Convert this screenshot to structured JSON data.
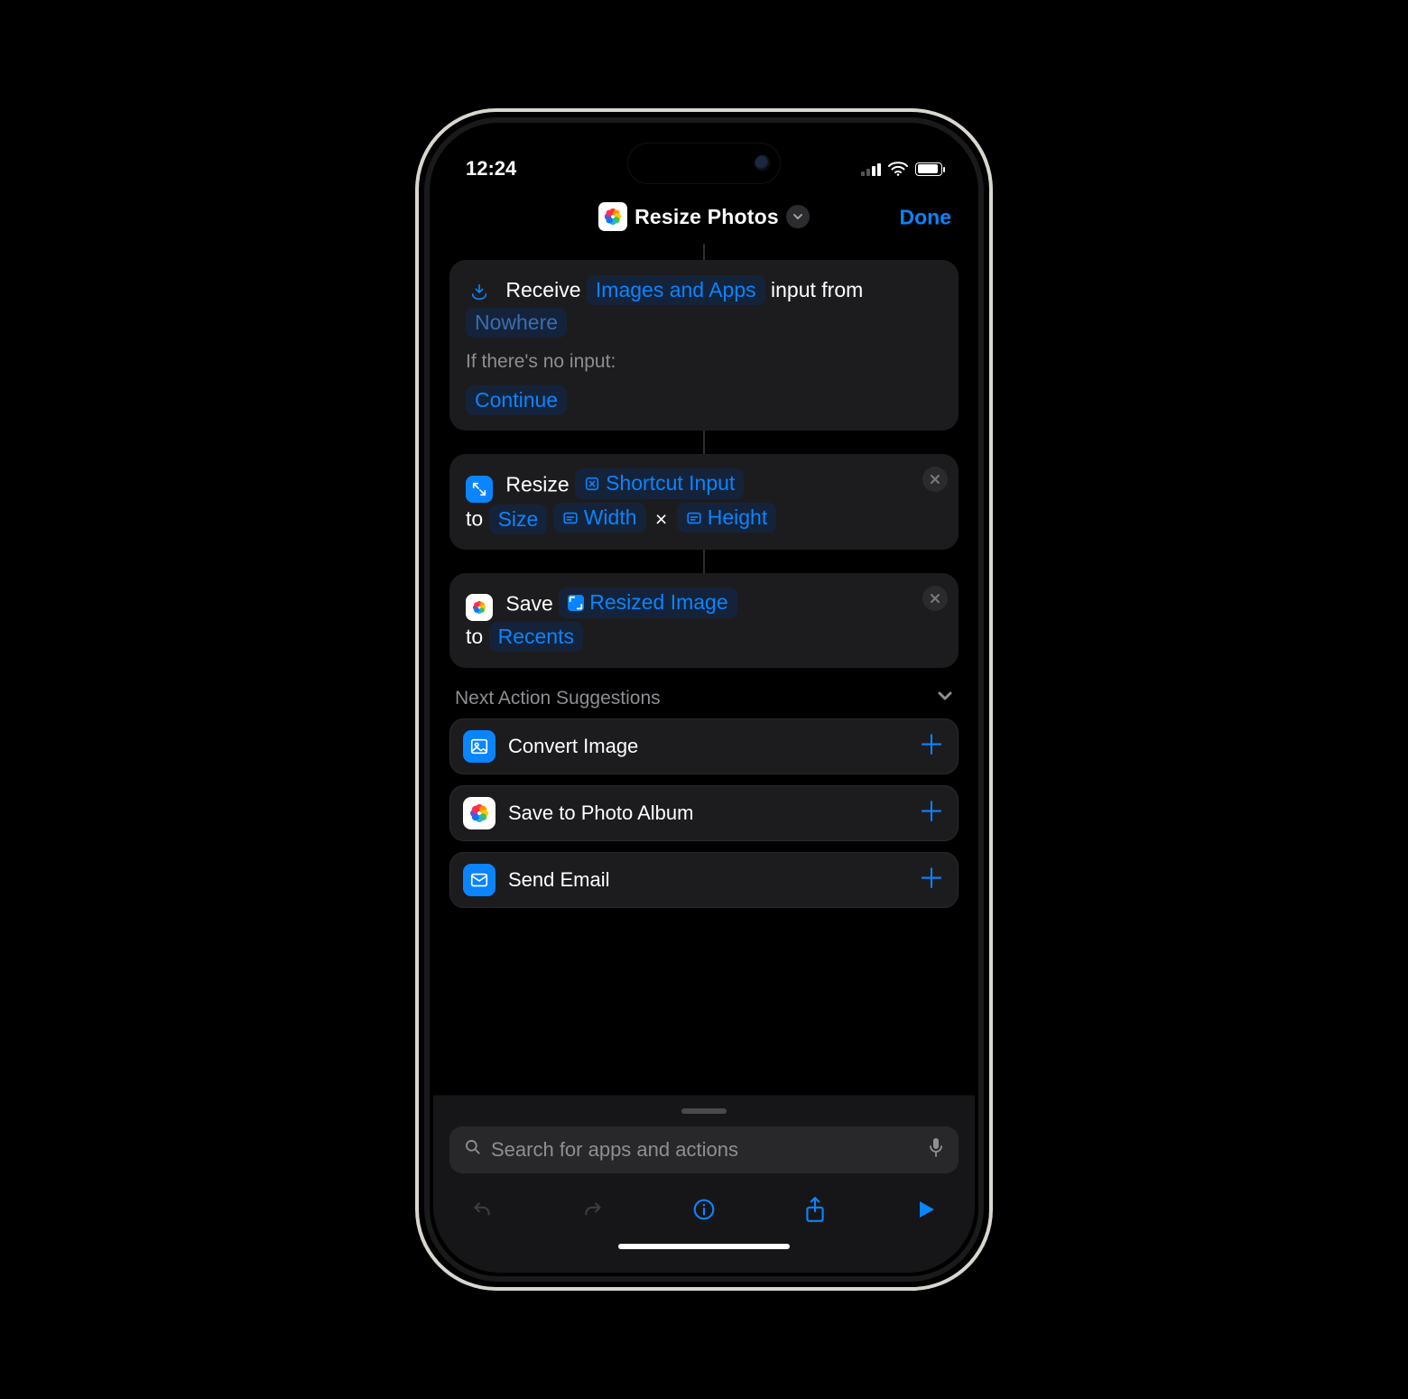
{
  "statusbar": {
    "time": "12:24",
    "signal_active_bars": 2
  },
  "navbar": {
    "title": "Resize Photos",
    "done": "Done"
  },
  "cards": {
    "receive": {
      "word_receive": "Receive",
      "types_token": "Images and Apps",
      "word_input_from": "input from",
      "source_token": "Nowhere",
      "no_input_label": "If there's no input:",
      "fallback_token": "Continue"
    },
    "resize": {
      "word_resize": "Resize",
      "input_token": "Shortcut Input",
      "word_to": "to",
      "size_token": "Size",
      "width_token": "Width",
      "times": "×",
      "height_token": "Height"
    },
    "save": {
      "word_save": "Save",
      "what_token": "Resized Image",
      "word_to": "to",
      "dest_token": "Recents"
    }
  },
  "suggestions": {
    "header": "Next Action Suggestions",
    "items": [
      {
        "label": "Convert Image",
        "icon": "image"
      },
      {
        "label": "Save to Photo Album",
        "icon": "photos"
      },
      {
        "label": "Send Email",
        "icon": "mail"
      }
    ]
  },
  "search": {
    "placeholder": "Search for apps and actions"
  }
}
